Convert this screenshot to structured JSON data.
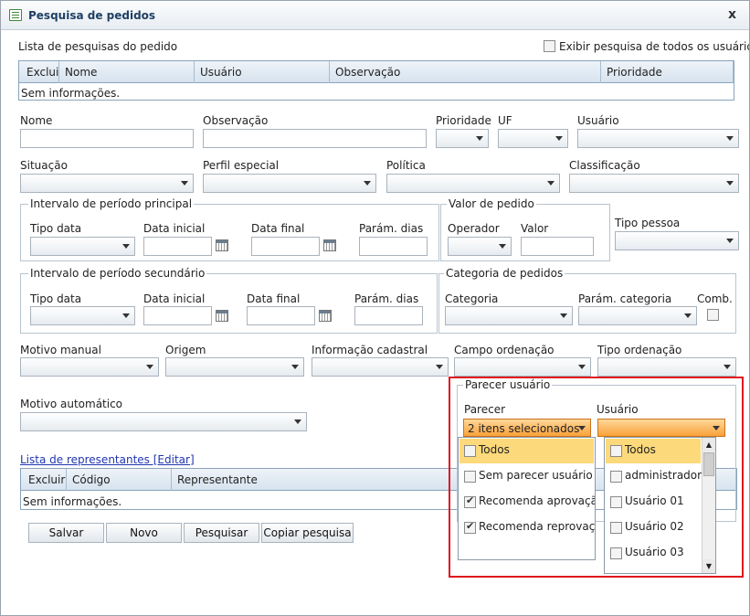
{
  "window": {
    "title": "Pesquisa de pedidos",
    "close_glyph": "x",
    "icon": "form-icon"
  },
  "saved_searches": {
    "label": "Lista de pesquisas do pedido",
    "show_all_label": "Exibir pesquisa de todos os usuários",
    "columns": [
      "Excluir",
      "Nome",
      "Usuário",
      "Observação",
      "Prioridade"
    ],
    "empty_text": "Sem informações."
  },
  "fields": {
    "nome": "Nome",
    "observacao": "Observação",
    "prioridade": "Prioridade",
    "uf": "UF",
    "usuario": "Usuário",
    "situacao": "Situação",
    "perfil_especial": "Perfil especial",
    "politica": "Política",
    "classificacao": "Classificação",
    "tipo_pessoa": "Tipo pessoa",
    "motivo_manual": "Motivo manual",
    "origem": "Origem",
    "informacao_cadastral": "Informação cadastral",
    "campo_ordenacao": "Campo ordenação",
    "tipo_ordenacao": "Tipo ordenação",
    "motivo_automatico": "Motivo automático"
  },
  "periodo_principal": {
    "legend": "Intervalo de período principal",
    "tipo_data": "Tipo data",
    "data_inicial": "Data inicial",
    "data_final": "Data final",
    "param_dias": "Parám. dias"
  },
  "valor_pedido": {
    "legend": "Valor de pedido",
    "operador": "Operador",
    "valor": "Valor"
  },
  "periodo_secundario": {
    "legend": "Intervalo de período secundário",
    "tipo_data": "Tipo data",
    "data_inicial": "Data inicial",
    "data_final": "Data final",
    "param_dias": "Parám. dias"
  },
  "categoria_pedidos": {
    "legend": "Categoria de pedidos",
    "categoria": "Categoria",
    "param_categoria": "Parám. categoria",
    "comb": "Comb."
  },
  "parecer_usuario": {
    "legend": "Parecer usuário",
    "parecer_label": "Parecer",
    "parecer_value": "2 itens selecionados",
    "usuario_label": "Usuário",
    "usuario_value": "",
    "parecer_options": [
      {
        "label": "Todos",
        "checked": false,
        "highlighted": true
      },
      {
        "label": "Sem parecer usuário",
        "checked": false,
        "highlighted": false
      },
      {
        "label": "Recomenda aprovação",
        "checked": true,
        "highlighted": false
      },
      {
        "label": "Recomenda reprovação",
        "checked": true,
        "highlighted": false
      }
    ],
    "usuario_options": [
      {
        "label": "Todos",
        "checked": false,
        "highlighted": true
      },
      {
        "label": "administrador",
        "checked": false,
        "highlighted": false
      },
      {
        "label": "Usuário 01",
        "checked": false,
        "highlighted": false
      },
      {
        "label": "Usuário 02",
        "checked": false,
        "highlighted": false
      },
      {
        "label": "Usuário 03",
        "checked": false,
        "highlighted": false
      }
    ]
  },
  "representantes": {
    "link": "Lista de representantes [Editar]",
    "columns": [
      "Excluir",
      "Código",
      "Representante"
    ],
    "empty_text": "Sem informações."
  },
  "buttons": {
    "salvar": "Salvar",
    "novo": "Novo",
    "pesquisar": "Pesquisar",
    "copiar": "Copiar pesquisa"
  },
  "colors": {
    "title_text": "#1f3f64",
    "highlight": "#fcd97a",
    "dropdown_active": "#f9a13a",
    "annotation_box": "#e0141e",
    "link": "#1f35b0"
  }
}
